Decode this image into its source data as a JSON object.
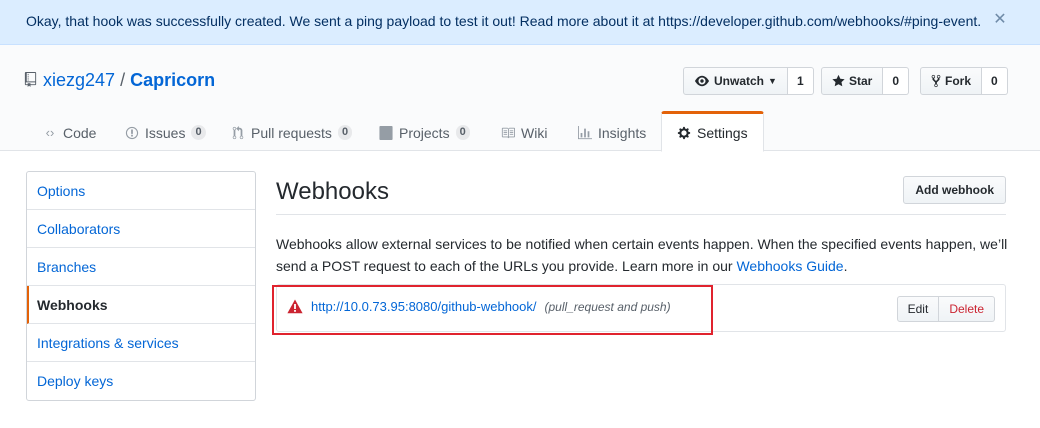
{
  "flash": {
    "message": "Okay, that hook was successfully created. We sent a ping payload to test it out! Read more about it at https://developer.github.com/webhooks/#ping-event.",
    "close_icon": "close-icon"
  },
  "repo": {
    "owner": "xiezg247",
    "separator": "/",
    "name": "Capricorn",
    "icon": "repo-book-icon"
  },
  "actions": {
    "watch_label": "Unwatch",
    "watch_count": "1",
    "star_label": "Star",
    "star_count": "0",
    "fork_label": "Fork",
    "fork_count": "0"
  },
  "tabs": [
    {
      "label": "Code",
      "icon": "code-icon"
    },
    {
      "label": "Issues",
      "count": "0",
      "icon": "issue-icon"
    },
    {
      "label": "Pull requests",
      "count": "0",
      "icon": "pull-request-icon"
    },
    {
      "label": "Projects",
      "count": "0",
      "icon": "project-icon"
    },
    {
      "label": "Wiki",
      "icon": "book-icon"
    },
    {
      "label": "Insights",
      "icon": "graph-icon"
    },
    {
      "label": "Settings",
      "icon": "gear-icon",
      "selected": true
    }
  ],
  "sidebar": {
    "items": [
      {
        "label": "Options"
      },
      {
        "label": "Collaborators"
      },
      {
        "label": "Branches"
      },
      {
        "label": "Webhooks",
        "selected": true
      },
      {
        "label": "Integrations & services"
      },
      {
        "label": "Deploy keys"
      }
    ]
  },
  "main": {
    "heading": "Webhooks",
    "add_button": "Add webhook",
    "description": "Webhooks allow external services to be notified when certain events happen. When the specified events happen, we’ll send a POST request to each of the URLs you provide. Learn more in our",
    "guide_link": "Webhooks Guide",
    "description_end": ".",
    "hook": {
      "url": "http://10.0.73.95:8080/github-webhook/",
      "events": "(pull_request and push)",
      "status_icon": "alert-icon",
      "edit_label": "Edit",
      "delete_label": "Delete"
    }
  },
  "colors": {
    "accent": "#e36209",
    "link": "#0366d6",
    "danger": "#cb2431",
    "highlight": "#e0232e",
    "flash_bg": "#dbedff"
  }
}
